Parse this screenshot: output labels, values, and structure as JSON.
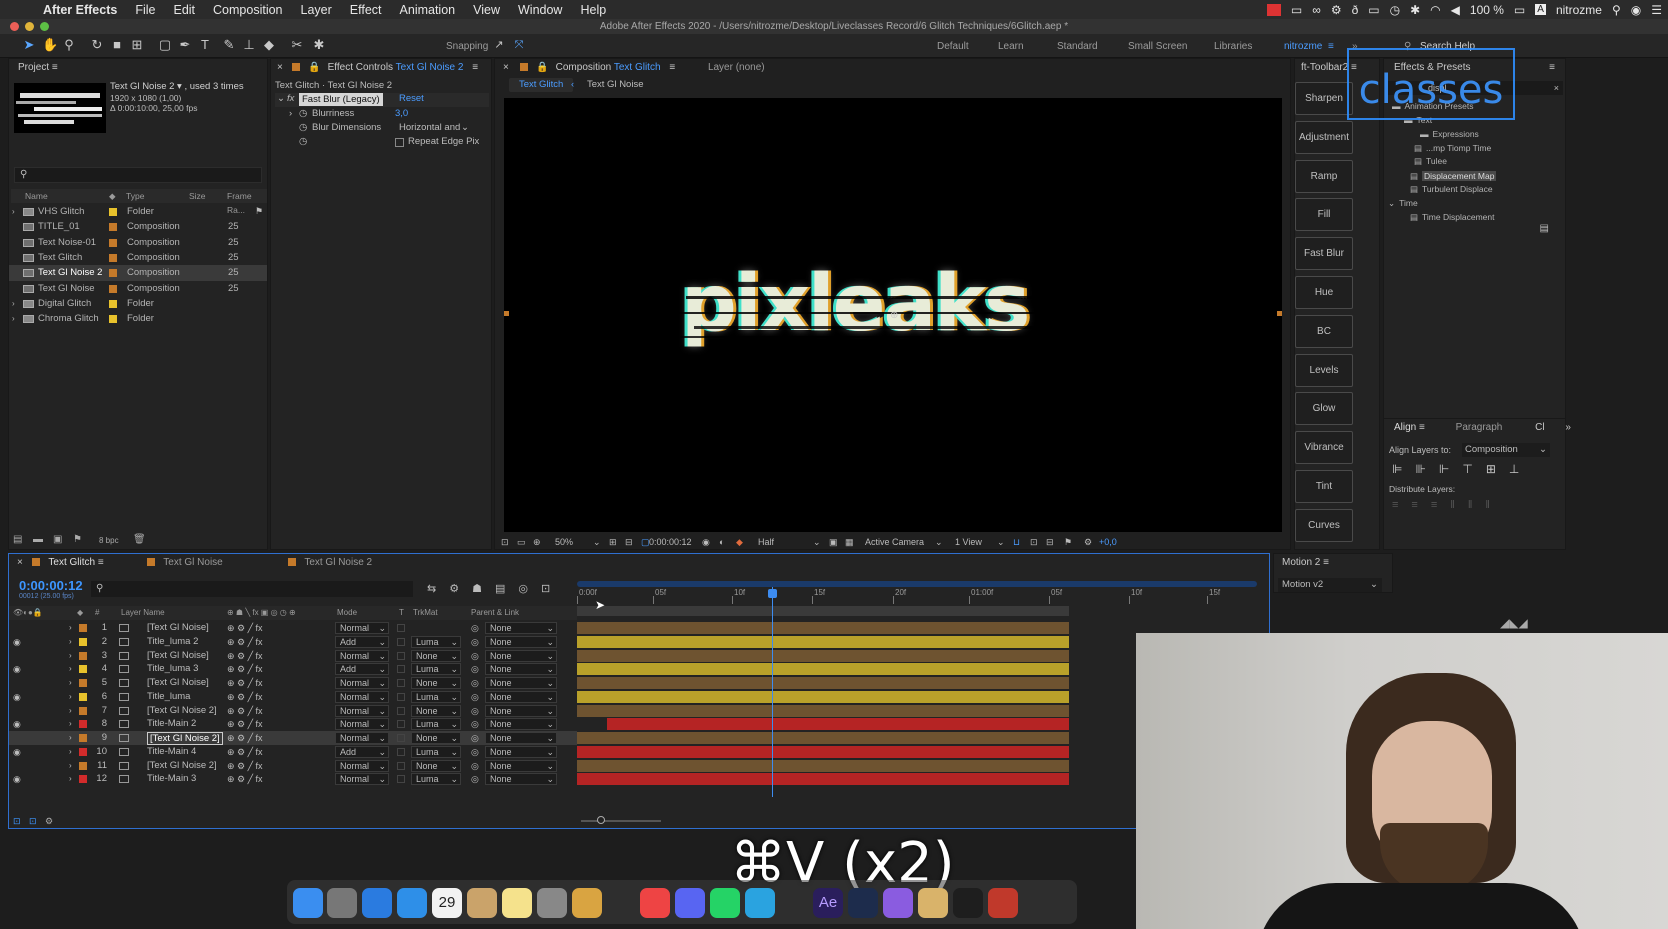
{
  "menubar": {
    "app": "After Effects",
    "items": [
      "File",
      "Edit",
      "Composition",
      "Layer",
      "Effect",
      "Animation",
      "View",
      "Window",
      "Help"
    ],
    "battery": "100 %",
    "user": "nitrozme"
  },
  "window_title": "Adobe After Effects 2020 - /Users/nitrozme/Desktop/Liveclasses Record/6 Glitch Techniques/6Glitch.aep *",
  "toolbar": {
    "snapping": "Snapping",
    "workspaces": [
      "Default",
      "Learn",
      "Standard",
      "Small Screen",
      "Libraries",
      "nitrozme"
    ],
    "search": "Search Help"
  },
  "project": {
    "title": "Project",
    "thumb_name": "Text Gl Noise 2 ▾ , used 3 times",
    "thumb_res": "1920 x 1080 (1,00)",
    "thumb_dur": "Δ 0:00:10:00, 25,00 fps",
    "columns": [
      "Name",
      "Type",
      "Size",
      "Frame Ra..."
    ],
    "items": [
      {
        "name": "VHS Glitch",
        "type": "Folder",
        "fps": "",
        "color": "#e8c22c",
        "folder": true
      },
      {
        "name": "TITLE_01",
        "type": "Composition",
        "fps": "25",
        "color": "#c57a2a",
        "folder": false
      },
      {
        "name": "Text Noise-01",
        "type": "Composition",
        "fps": "25",
        "color": "#c57a2a",
        "folder": false
      },
      {
        "name": "Text Glitch",
        "type": "Composition",
        "fps": "25",
        "color": "#c57a2a",
        "folder": false
      },
      {
        "name": "Text Gl Noise 2",
        "type": "Composition",
        "fps": "25",
        "color": "#c57a2a",
        "folder": false
      },
      {
        "name": "Text Gl Noise",
        "type": "Composition",
        "fps": "25",
        "color": "#c57a2a",
        "folder": false
      },
      {
        "name": "Digital Glitch",
        "type": "Folder",
        "fps": "",
        "color": "#e8c22c",
        "folder": true
      },
      {
        "name": "Chroma Glitch",
        "type": "Folder",
        "fps": "",
        "color": "#e8c22c",
        "folder": true
      }
    ],
    "bpc": "8 bpc"
  },
  "effect_controls": {
    "tab": "Effect Controls",
    "tab_target": "Text Gl Noise 2",
    "subtitle": "Text Glitch · Text Gl Noise 2",
    "effect": "Fast Blur (Legacy)",
    "reset": "Reset",
    "props": [
      {
        "label": "Blurriness",
        "value": "3,0"
      },
      {
        "label": "Blur Dimensions",
        "value": "Horizontal and"
      },
      {
        "label": "",
        "value": "Repeat Edge Pix"
      }
    ]
  },
  "composition": {
    "tab": "Composition",
    "tab_target": "Text Glitch",
    "layer_tab": "Layer (none)",
    "crumbs": [
      "Text Glitch",
      "Text Gl Noise"
    ],
    "viewer_text": "pixleaks",
    "zoom": "50%",
    "timecode": "0:00:00:12",
    "resolution": "Half",
    "camera": "Active Camera",
    "views": "1 View",
    "exposure": "+0,0"
  },
  "ft_toolbar": {
    "title": "ft-Toolbar2",
    "buttons": [
      "Sharpen",
      "Adjustment",
      "Ramp",
      "Fill",
      "Fast Blur",
      "Hue",
      "BC",
      "Levels",
      "Glow",
      "Vibrance",
      "Tint",
      "Curves"
    ]
  },
  "effects_presets": {
    "title": "Effects & Presets",
    "logo": "classes",
    "search": "displ",
    "items": [
      "Animation Presets",
      "Text",
      "Expressions",
      "...mp Tiomp Time",
      "Tulee",
      "Displacement Map",
      "Turbulent Displace",
      "Time",
      "Time Displacement"
    ]
  },
  "align": {
    "tab": "Align",
    "tab2": "Paragraph",
    "label": "Align Layers to:",
    "target": "Composition",
    "distribute": "Distribute Layers:"
  },
  "timeline": {
    "tabs": [
      "Text Glitch",
      "Text Gl Noise",
      "Text Gl Noise 2"
    ],
    "timecode": "0:00:00:12",
    "frames": "00012 (25.00 fps)",
    "columns": [
      "#",
      "Layer Name",
      "Mode",
      "T",
      "TrkMat",
      "Parent & Link"
    ],
    "ruler": [
      "0:00f",
      "05f",
      "10f",
      "15f",
      "20f",
      "01:00f",
      "05f",
      "10f",
      "15f"
    ],
    "layers": [
      {
        "num": "1",
        "name": "[Text Gl Noise]",
        "color": "#c57a2a",
        "mode": "Normal",
        "trk": "",
        "parent": "None",
        "eye": false
      },
      {
        "num": "2",
        "name": "Title_luma 2",
        "color": "#e8c22c",
        "mode": "Add",
        "trk": "Luma",
        "parent": "None",
        "eye": true
      },
      {
        "num": "3",
        "name": "[Text Gl Noise]",
        "color": "#c57a2a",
        "mode": "Normal",
        "trk": "None",
        "parent": "None",
        "eye": false
      },
      {
        "num": "4",
        "name": "Title_luma 3",
        "color": "#e8c22c",
        "mode": "Add",
        "trk": "Luma",
        "parent": "None",
        "eye": true
      },
      {
        "num": "5",
        "name": "[Text Gl Noise]",
        "color": "#c57a2a",
        "mode": "Normal",
        "trk": "None",
        "parent": "None",
        "eye": false
      },
      {
        "num": "6",
        "name": "Title_luma",
        "color": "#e8c22c",
        "mode": "Normal",
        "trk": "Luma",
        "parent": "None",
        "eye": true
      },
      {
        "num": "7",
        "name": "[Text Gl Noise 2]",
        "color": "#c57a2a",
        "mode": "Normal",
        "trk": "None",
        "parent": "None",
        "eye": false
      },
      {
        "num": "8",
        "name": "Title-Main 2",
        "color": "#d22b2b",
        "mode": "Normal",
        "trk": "Luma",
        "parent": "None",
        "eye": true
      },
      {
        "num": "9",
        "name": "[Text Gl Noise 2]",
        "color": "#c57a2a",
        "mode": "Normal",
        "trk": "None",
        "parent": "None",
        "eye": false
      },
      {
        "num": "10",
        "name": "Title-Main 4",
        "color": "#d22b2b",
        "mode": "Add",
        "trk": "Luma",
        "parent": "None",
        "eye": true
      },
      {
        "num": "11",
        "name": "[Text Gl Noise 2]",
        "color": "#c57a2a",
        "mode": "Normal",
        "trk": "None",
        "parent": "None",
        "eye": false
      },
      {
        "num": "12",
        "name": "Title-Main 3",
        "color": "#d22b2b",
        "mode": "Normal",
        "trk": "Luma",
        "parent": "None",
        "eye": true
      }
    ]
  },
  "motion": {
    "title": "Motion 2",
    "version": "Motion v2"
  },
  "overlay_shortcut": "⌘V (x2)",
  "dock": {
    "icons": [
      "finder-icon",
      "launchpad-icon",
      "app-store-icon",
      "safari-icon",
      "calendar-icon",
      "contacts-icon",
      "notes-icon",
      "system-preferences-icon",
      "cleaner-icon",
      "chrome-icon",
      "discord-icon",
      "whatsapp-icon",
      "telegram-icon",
      "after-effects-icon",
      "cinema4d-icon",
      "paw-icon",
      "bottle-icon",
      "media-encoder-icon",
      "app-icon"
    ],
    "calendar_day": "29"
  }
}
